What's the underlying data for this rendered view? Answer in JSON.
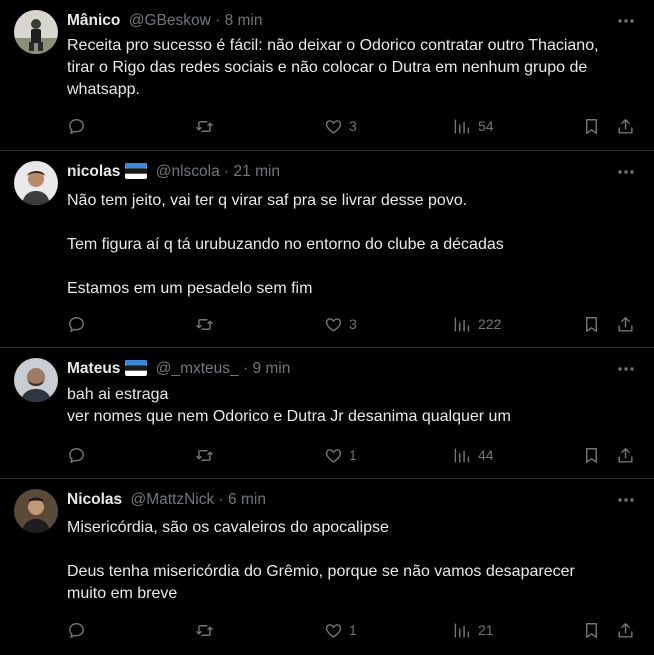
{
  "tweets": [
    {
      "name": "Mânico",
      "flag": false,
      "handle": "@GBeskow",
      "time": "8 min",
      "lines": [
        "Receita pro sucesso é fácil: não deixar o Odorico contratar outro Thaciano,",
        "tirar o Rigo das redes sociais e não colocar o Dutra em nenhum grupo de",
        "whatsapp."
      ],
      "likes": "3",
      "views": "54"
    },
    {
      "name": "nicolas",
      "flag": true,
      "handle": "@nlscola",
      "time": "21 min",
      "lines": [
        "Não tem jeito, vai ter q virar saf pra se livrar desse povo.",
        "",
        "Tem figura aí q tá urubuzando no entorno do clube a décadas",
        "",
        "Estamos em um pesadelo sem fim"
      ],
      "likes": "3",
      "views": "222"
    },
    {
      "name": "Mateus",
      "flag": true,
      "handle": "@_mxteus_",
      "time": "9 min",
      "lines": [
        "bah ai estraga",
        "ver nomes que nem Odorico e Dutra Jr desanima qualquer um"
      ],
      "likes": "1",
      "views": "44"
    },
    {
      "name": "Nicolas",
      "flag": false,
      "handle": "@MattzNick",
      "time": "6 min",
      "lines": [
        "Misericórdia, são os cavaleiros do apocalipse",
        "",
        "Deus tenha misericórdia do Grêmio, porque se não vamos desaparecer",
        "muito em breve"
      ],
      "likes": "1",
      "views": "21"
    }
  ],
  "sep": "·",
  "icons": [
    "reply-icon",
    "retweet-icon",
    "heart-icon",
    "views-icon",
    "bookmark-icon",
    "share-icon",
    "more-icon"
  ],
  "colors": {
    "bg": "#000000",
    "text": "#e7e9ea",
    "muted": "#71767b",
    "border": "#2f3336"
  }
}
